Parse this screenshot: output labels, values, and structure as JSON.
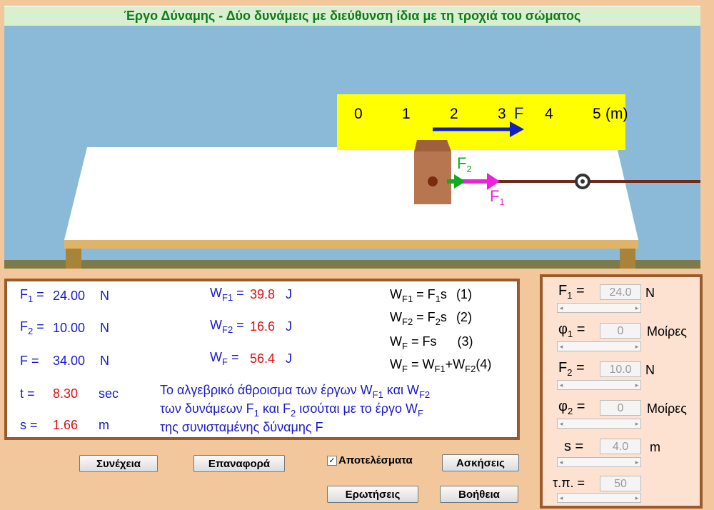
{
  "title": "Έργο Δύναμης - Δύο δυνάμεις με διεύθυνση ίδια με τη τροχιά του σώματος",
  "scene": {
    "ruler_ticks": [
      "0",
      "1",
      "2",
      "3",
      "4",
      "5"
    ],
    "ruler_unit": "(m)",
    "force_label": "F",
    "f1_label": "F",
    "f1_sub": "1",
    "f2_label": "F",
    "f2_sub": "2"
  },
  "results": {
    "f1": {
      "name": "F",
      "sub": "1",
      "value": "24.00",
      "unit": "N"
    },
    "f2": {
      "name": "F",
      "sub": "2",
      "value": "10.00",
      "unit": "N"
    },
    "f": {
      "name": "F",
      "value": "34.00",
      "unit": "N"
    },
    "t": {
      "name": "t",
      "value": "8.30",
      "unit": "sec"
    },
    "s": {
      "name": "s",
      "value": "1.66",
      "unit": "m"
    },
    "wf1": {
      "name": "W",
      "sub": "F1",
      "value": "39.8",
      "unit": "J"
    },
    "wf2": {
      "name": "W",
      "sub": "F2",
      "value": "16.6",
      "unit": "J"
    },
    "wf": {
      "name": "W",
      "sub": "F",
      "value": "56.4",
      "unit": "J"
    }
  },
  "formulas": {
    "eq1_num": "(1)",
    "eq2_num": "(2)",
    "eq3_num": "(3)",
    "eq4_num": "(4)"
  },
  "explanation": {
    "line1": "Το αλγεβρικό άθροισμα των έργων W",
    "line1_sub1": "F1",
    "line1_mid": " και W",
    "line1_sub2": "F2",
    "line2": "των δυνάμεων F",
    "line2_sub1": "1",
    "line2_mid": " και F",
    "line2_sub2": "2",
    "line2_end": " ισούται με το έργο W",
    "line2_sub3": "F",
    "line3": "της συνισταμένης  δύναμης F"
  },
  "controls": {
    "f1": {
      "label": "F",
      "sub": "1",
      "eq": " =",
      "value": "24.0",
      "unit": "N"
    },
    "phi1": {
      "label": "φ",
      "sub": "1",
      "eq": " =",
      "value": "0",
      "unit": "Μοίρες"
    },
    "f2": {
      "label": "F",
      "sub": "2",
      "eq": " =",
      "value": "10.0",
      "unit": "N"
    },
    "phi2": {
      "label": "φ",
      "sub": "2",
      "eq": " =",
      "value": "0",
      "unit": "Μοίρες"
    },
    "s": {
      "label": "s",
      "eq": "  =",
      "value": "4.0",
      "unit": "m"
    },
    "tp": {
      "label": "τ.π. =",
      "value": "50"
    }
  },
  "buttons": {
    "continue": "Συνέχεια",
    "reset": "Επαναφορά",
    "results_checkbox": "Αποτελέσματα",
    "exercises": "Ασκήσεις",
    "questions": "Ερωτήσεις",
    "help": "Βοήθεια"
  },
  "colors": {
    "sky": "#8bbad8",
    "ruler": "#ffff00",
    "panel_border": "#9b5a2a",
    "background": "#f3c79c"
  }
}
